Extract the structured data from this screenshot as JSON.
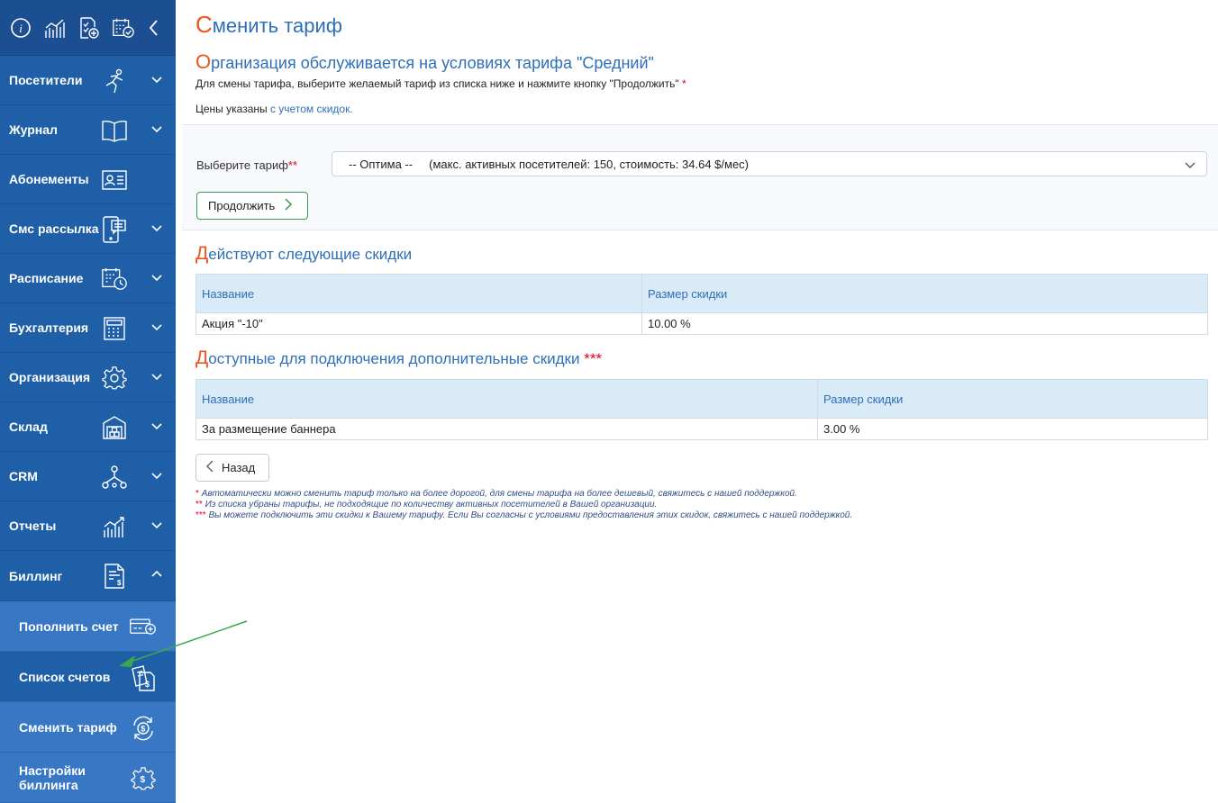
{
  "sidebar": {
    "menu": [
      {
        "label": "Посетители",
        "icon": "runner-icon",
        "chevron": "down"
      },
      {
        "label": "Журнал",
        "icon": "book-icon",
        "chevron": "down"
      },
      {
        "label": "Абонементы",
        "icon": "id-card-icon",
        "chevron": ""
      },
      {
        "label": "Смс рассылка",
        "icon": "phone-message-icon",
        "chevron": "down"
      },
      {
        "label": "Расписание",
        "icon": "calendar-clock-icon",
        "chevron": "down"
      },
      {
        "label": "Бухгалтерия",
        "icon": "calculator-icon",
        "chevron": "down"
      },
      {
        "label": "Организация",
        "icon": "gear-icon",
        "chevron": "down"
      },
      {
        "label": "Склад",
        "icon": "warehouse-icon",
        "chevron": "down"
      },
      {
        "label": "CRM",
        "icon": "network-icon",
        "chevron": "down"
      },
      {
        "label": "Отчеты",
        "icon": "chart-icon",
        "chevron": "down"
      },
      {
        "label": "Биллинг",
        "icon": "invoice-icon",
        "chevron": "up"
      }
    ],
    "billing_sub": [
      {
        "label": "Пополнить счет",
        "icon": "card-plus-icon"
      },
      {
        "label": "Список счетов",
        "icon": "invoices-list-icon"
      },
      {
        "label": "Сменить тариф",
        "icon": "dollar-refresh-icon"
      },
      {
        "label": "Настройки биллинга",
        "icon": "gear-dollar-icon"
      }
    ]
  },
  "page": {
    "title_first": "С",
    "title_rest": "менить тариф",
    "subtitle_first": "О",
    "subtitle_rest": "рганизация обслуживается на условиях тарифа \"Средний\"",
    "hint1": "Для смены тарифа, выберите желаемый тариф из списка ниже и нажмите кнопку \"Продолжить\"",
    "hint1_star": "*",
    "hint2_prefix": "Цены указаны",
    "hint2_link": "с учетом скидок."
  },
  "tariff": {
    "label": "Выберите тариф",
    "label_star": "**",
    "selected": "-- Оптима --     (макс. активных посетителей: 150, стоимость: 34.64 $/мес)",
    "continue_label": "Продолжить"
  },
  "discounts": {
    "title_first": "Д",
    "title_rest": "ействуют следующие скидки",
    "headers": [
      "Название",
      "Размер скидки"
    ],
    "rows": [
      [
        "Акция \"-10\"",
        "10.00 %"
      ]
    ]
  },
  "extra_discounts": {
    "title_first": "Д",
    "title_rest": "оступные для подключения дополнительные скидки",
    "title_star": "***",
    "headers": [
      "Название",
      "Размер скидки"
    ],
    "rows": [
      [
        "За размещение баннера",
        "3.00 %"
      ]
    ]
  },
  "back_label": "Назад",
  "footnotes": [
    {
      "star": "*",
      "text": "Автоматически можно сменить тариф только на более дорогой, для смены тарифа на более дешевый, свяжитесь с нашей поддержкой."
    },
    {
      "star": "**",
      "text": "Из списка убраны тарифы, не подходящие по количеству активных посетителей в Вашей организации."
    },
    {
      "star": "***",
      "text": "Вы можете подключить эти скидки к Вашему тарифу. Если Вы согласны с условиями предоставления этих скидок, свяжитесь с нашей поддержкой."
    }
  ],
  "colors": {
    "accent": "#2e6fb8",
    "capital": "#f0541e",
    "sidebar": "#1f5fa8",
    "arrow": "#3aa94a"
  }
}
